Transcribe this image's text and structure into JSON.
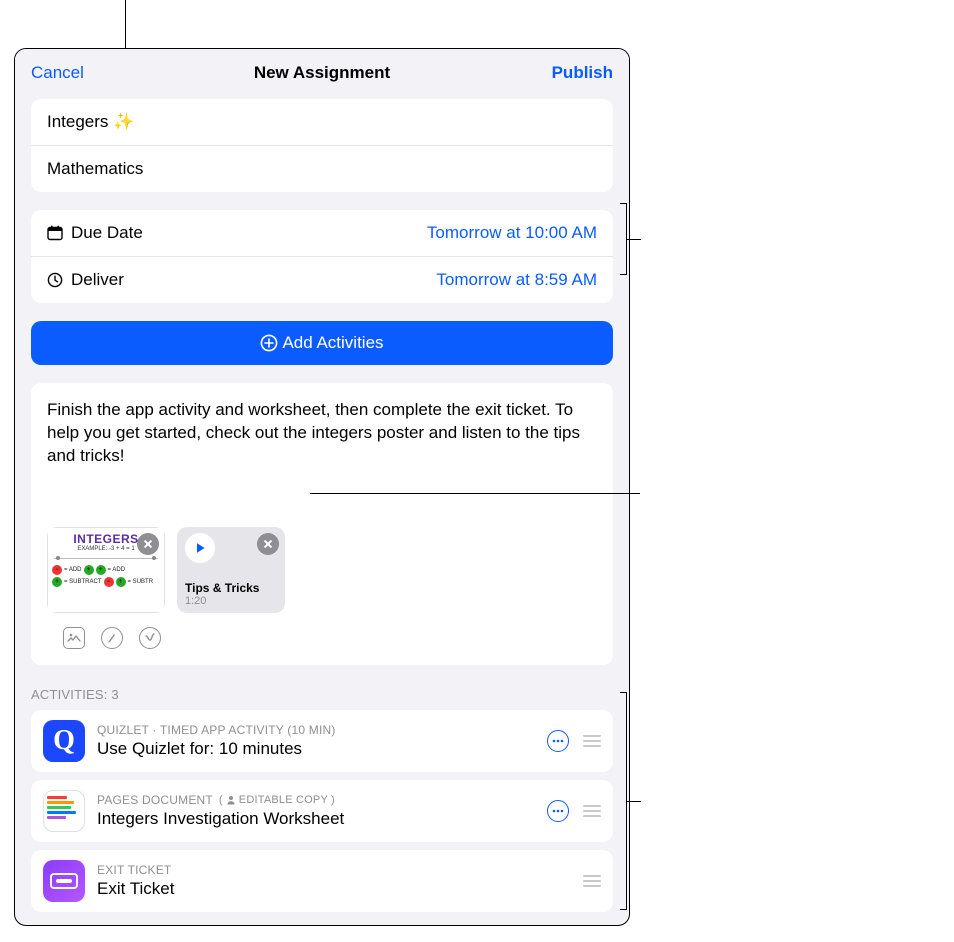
{
  "nav": {
    "cancel": "Cancel",
    "title": "New Assignment",
    "publish": "Publish"
  },
  "assignment": {
    "title": "Integers ✨",
    "class": "Mathematics"
  },
  "dates": {
    "due_label": "Due Date",
    "due_value": "Tomorrow at 10:00 AM",
    "deliver_label": "Deliver",
    "deliver_value": "Tomorrow at 8:59 AM"
  },
  "add_activities_label": "Add Activities",
  "instructions": "Finish the app activity and worksheet, then complete the exit ticket. To help you get started, check out the integers poster and listen to the tips and tricks!",
  "attachments": {
    "poster_title": "INTEGERS",
    "audio_title": "Tips & Tricks",
    "audio_duration": "1:20"
  },
  "activities_header": "ACTIVITIES: 3",
  "activities": [
    {
      "meta": "QUIZLET · TIMED APP ACTIVITY (10 MIN)",
      "title": "Use Quizlet for: 10 minutes",
      "icon": "quizlet",
      "has_more": true
    },
    {
      "meta": "PAGES DOCUMENT",
      "badge": "EDITABLE COPY",
      "title": "Integers Investigation Worksheet",
      "icon": "pages",
      "has_more": true
    },
    {
      "meta": "EXIT TICKET",
      "title": "Exit Ticket",
      "icon": "ticket",
      "has_more": false
    }
  ]
}
